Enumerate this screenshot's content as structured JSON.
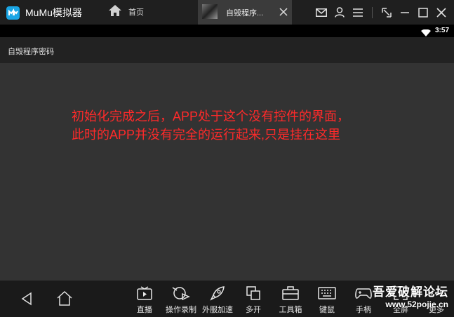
{
  "titlebar": {
    "app_title": "MuMu模拟器",
    "home_tab": "首页",
    "app_tab": "自毁程序...",
    "icons": [
      "home-icon",
      "mail-icon",
      "user-icon",
      "menu-icon",
      "pin-icon",
      "minimize-icon",
      "maximize-icon",
      "close-icon"
    ]
  },
  "statusbar": {
    "time": "3:57"
  },
  "appbar": {
    "title": "自毁程序密码"
  },
  "content": {
    "note_line1": "初始化完成之后，APP处于这个没有控件的界面，",
    "note_line2": "此时的APP并没有完全的运行起来,只是挂在这里",
    "note_color": "#ff2a2a"
  },
  "toolbar": {
    "items": [
      {
        "label": "直播",
        "icon": "live-icon"
      },
      {
        "label": "操作录制",
        "icon": "record-icon"
      },
      {
        "label": "外服加速",
        "icon": "rocket-icon"
      },
      {
        "label": "多开",
        "icon": "multi-instance-icon"
      },
      {
        "label": "工具箱",
        "icon": "toolbox-icon"
      },
      {
        "label": "键鼠",
        "icon": "keyboard-icon"
      },
      {
        "label": "手柄",
        "icon": "gamepad-icon"
      },
      {
        "label": "全屏",
        "icon": "fullscreen-icon"
      },
      {
        "label": "更多",
        "icon": "more-icon"
      }
    ]
  },
  "watermark": {
    "line1": "吾爱破解论坛",
    "line2": "www.52pojie.cn"
  }
}
